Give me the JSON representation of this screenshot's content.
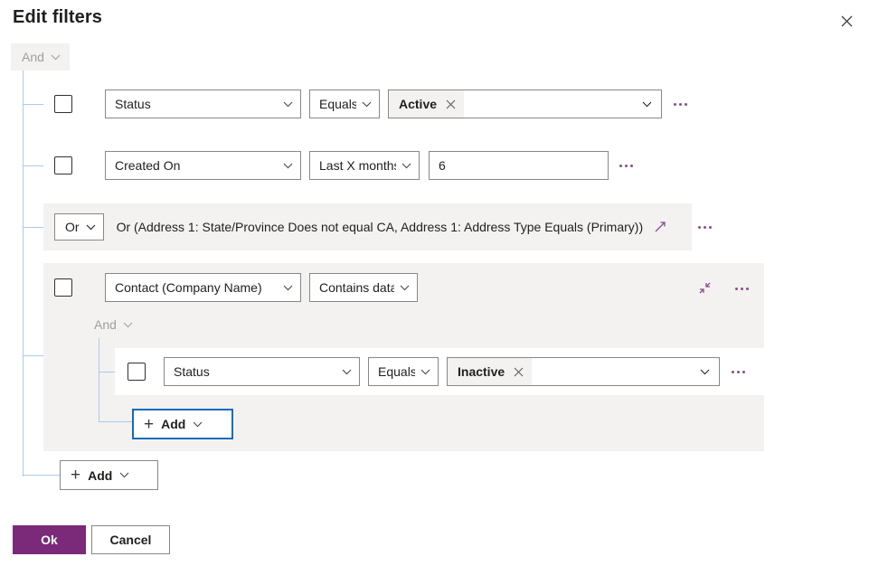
{
  "header": {
    "title": "Edit filters",
    "close_icon": "close-icon"
  },
  "root_group": {
    "operator": "And",
    "operator_icon": "chevron-down-icon"
  },
  "filters": [
    {
      "kind": "condition",
      "checkbox_checked": false,
      "field": "Status",
      "operator": "Equals",
      "value_type": "token",
      "value": "Active",
      "remove_value_icon": "close-icon",
      "menu_icon": "more-options-icon"
    },
    {
      "kind": "condition",
      "checkbox_checked": false,
      "field": "Created On",
      "operator": "Last X months",
      "value_type": "number",
      "value": "6",
      "menu_icon": "more-options-icon"
    },
    {
      "kind": "group_collapsed",
      "operator": "Or",
      "operator_icon": "chevron-down-icon",
      "summary": "Or (Address 1: State/Province Does not equal CA, Address 1: Address Type Equals (Primary))",
      "expand_icon": "expand-diagonal-icon",
      "menu_icon": "more-options-icon"
    },
    {
      "kind": "group_expanded",
      "checkbox_checked": false,
      "field": "Contact (Company Name)",
      "operator": "Contains data",
      "collapse_icon": "collapse-diagonal-icon",
      "menu_icon": "more-options-icon",
      "inner_operator": "And",
      "inner_operator_icon": "chevron-down-icon",
      "inner_rows": [
        {
          "checkbox_checked": false,
          "field": "Status",
          "operator": "Equals",
          "value": "Inactive",
          "remove_value_icon": "close-icon",
          "menu_icon": "more-options-icon"
        }
      ],
      "add": {
        "label": "Add",
        "plus_icon": "plus-icon",
        "caret_icon": "chevron-down-icon",
        "focused": true
      }
    }
  ],
  "root_add": {
    "label": "Add",
    "plus_icon": "plus-icon",
    "caret_icon": "chevron-down-icon",
    "focused": false
  },
  "footer": {
    "ok_label": "Ok",
    "cancel_label": "Cancel"
  },
  "colors": {
    "accent_purple": "#7a2a78",
    "icon_purple": "#8c4b8c",
    "tree_line_blue": "#a9c9f0",
    "focus_blue": "#0f6cbd",
    "group_bg": "#f3f2f1",
    "border_gray": "#8a8886",
    "muted_text": "#a19f9d"
  }
}
